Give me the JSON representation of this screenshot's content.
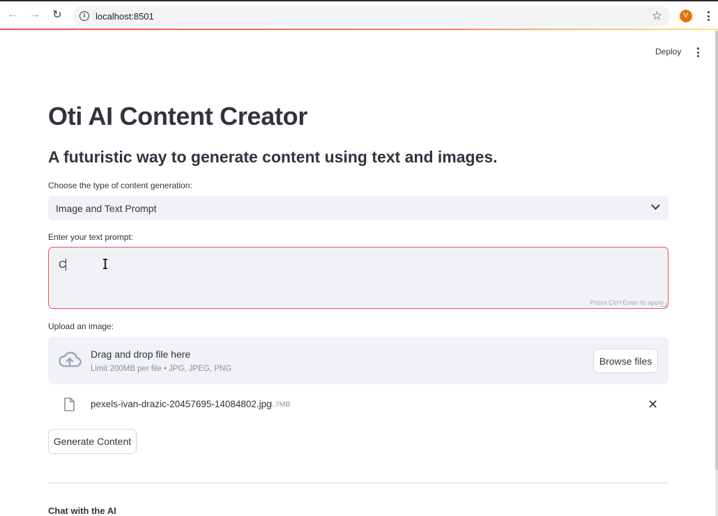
{
  "browser": {
    "url": "localhost:8501",
    "profile_initial": "V"
  },
  "header": {
    "deploy_label": "Deploy"
  },
  "main": {
    "title": "Oti AI Content Creator",
    "subtitle": "A futuristic way to generate content using text and images.",
    "content_type": {
      "label": "Choose the type of content generation:",
      "selected": "Image and Text Prompt"
    },
    "prompt": {
      "label": "Enter your text prompt:",
      "value": "C",
      "hint": "Press Ctrl+Enter to apply"
    },
    "upload": {
      "label": "Upload an image:",
      "drop_title": "Drag and drop file here",
      "limit": "Limit 200MB per file • JPG, JPEG, PNG",
      "browse_label": "Browse files",
      "file": {
        "name": "pexels-ivan-drazic-20457695-14084802.jpg",
        "size": "1.7MB"
      }
    },
    "generate_label": "Generate Content",
    "chat_heading": "Chat with the AI"
  },
  "colors": {
    "accent": "#ff4b4b",
    "input_bg": "#f0f2f6",
    "text": "#31333f",
    "muted": "#8c8f98"
  },
  "icons": [
    "back-icon",
    "forward-icon",
    "reload-icon",
    "info-icon",
    "star-icon",
    "kebab-icon",
    "chevron-down-icon",
    "cloud-upload-icon",
    "file-icon",
    "close-icon"
  ]
}
